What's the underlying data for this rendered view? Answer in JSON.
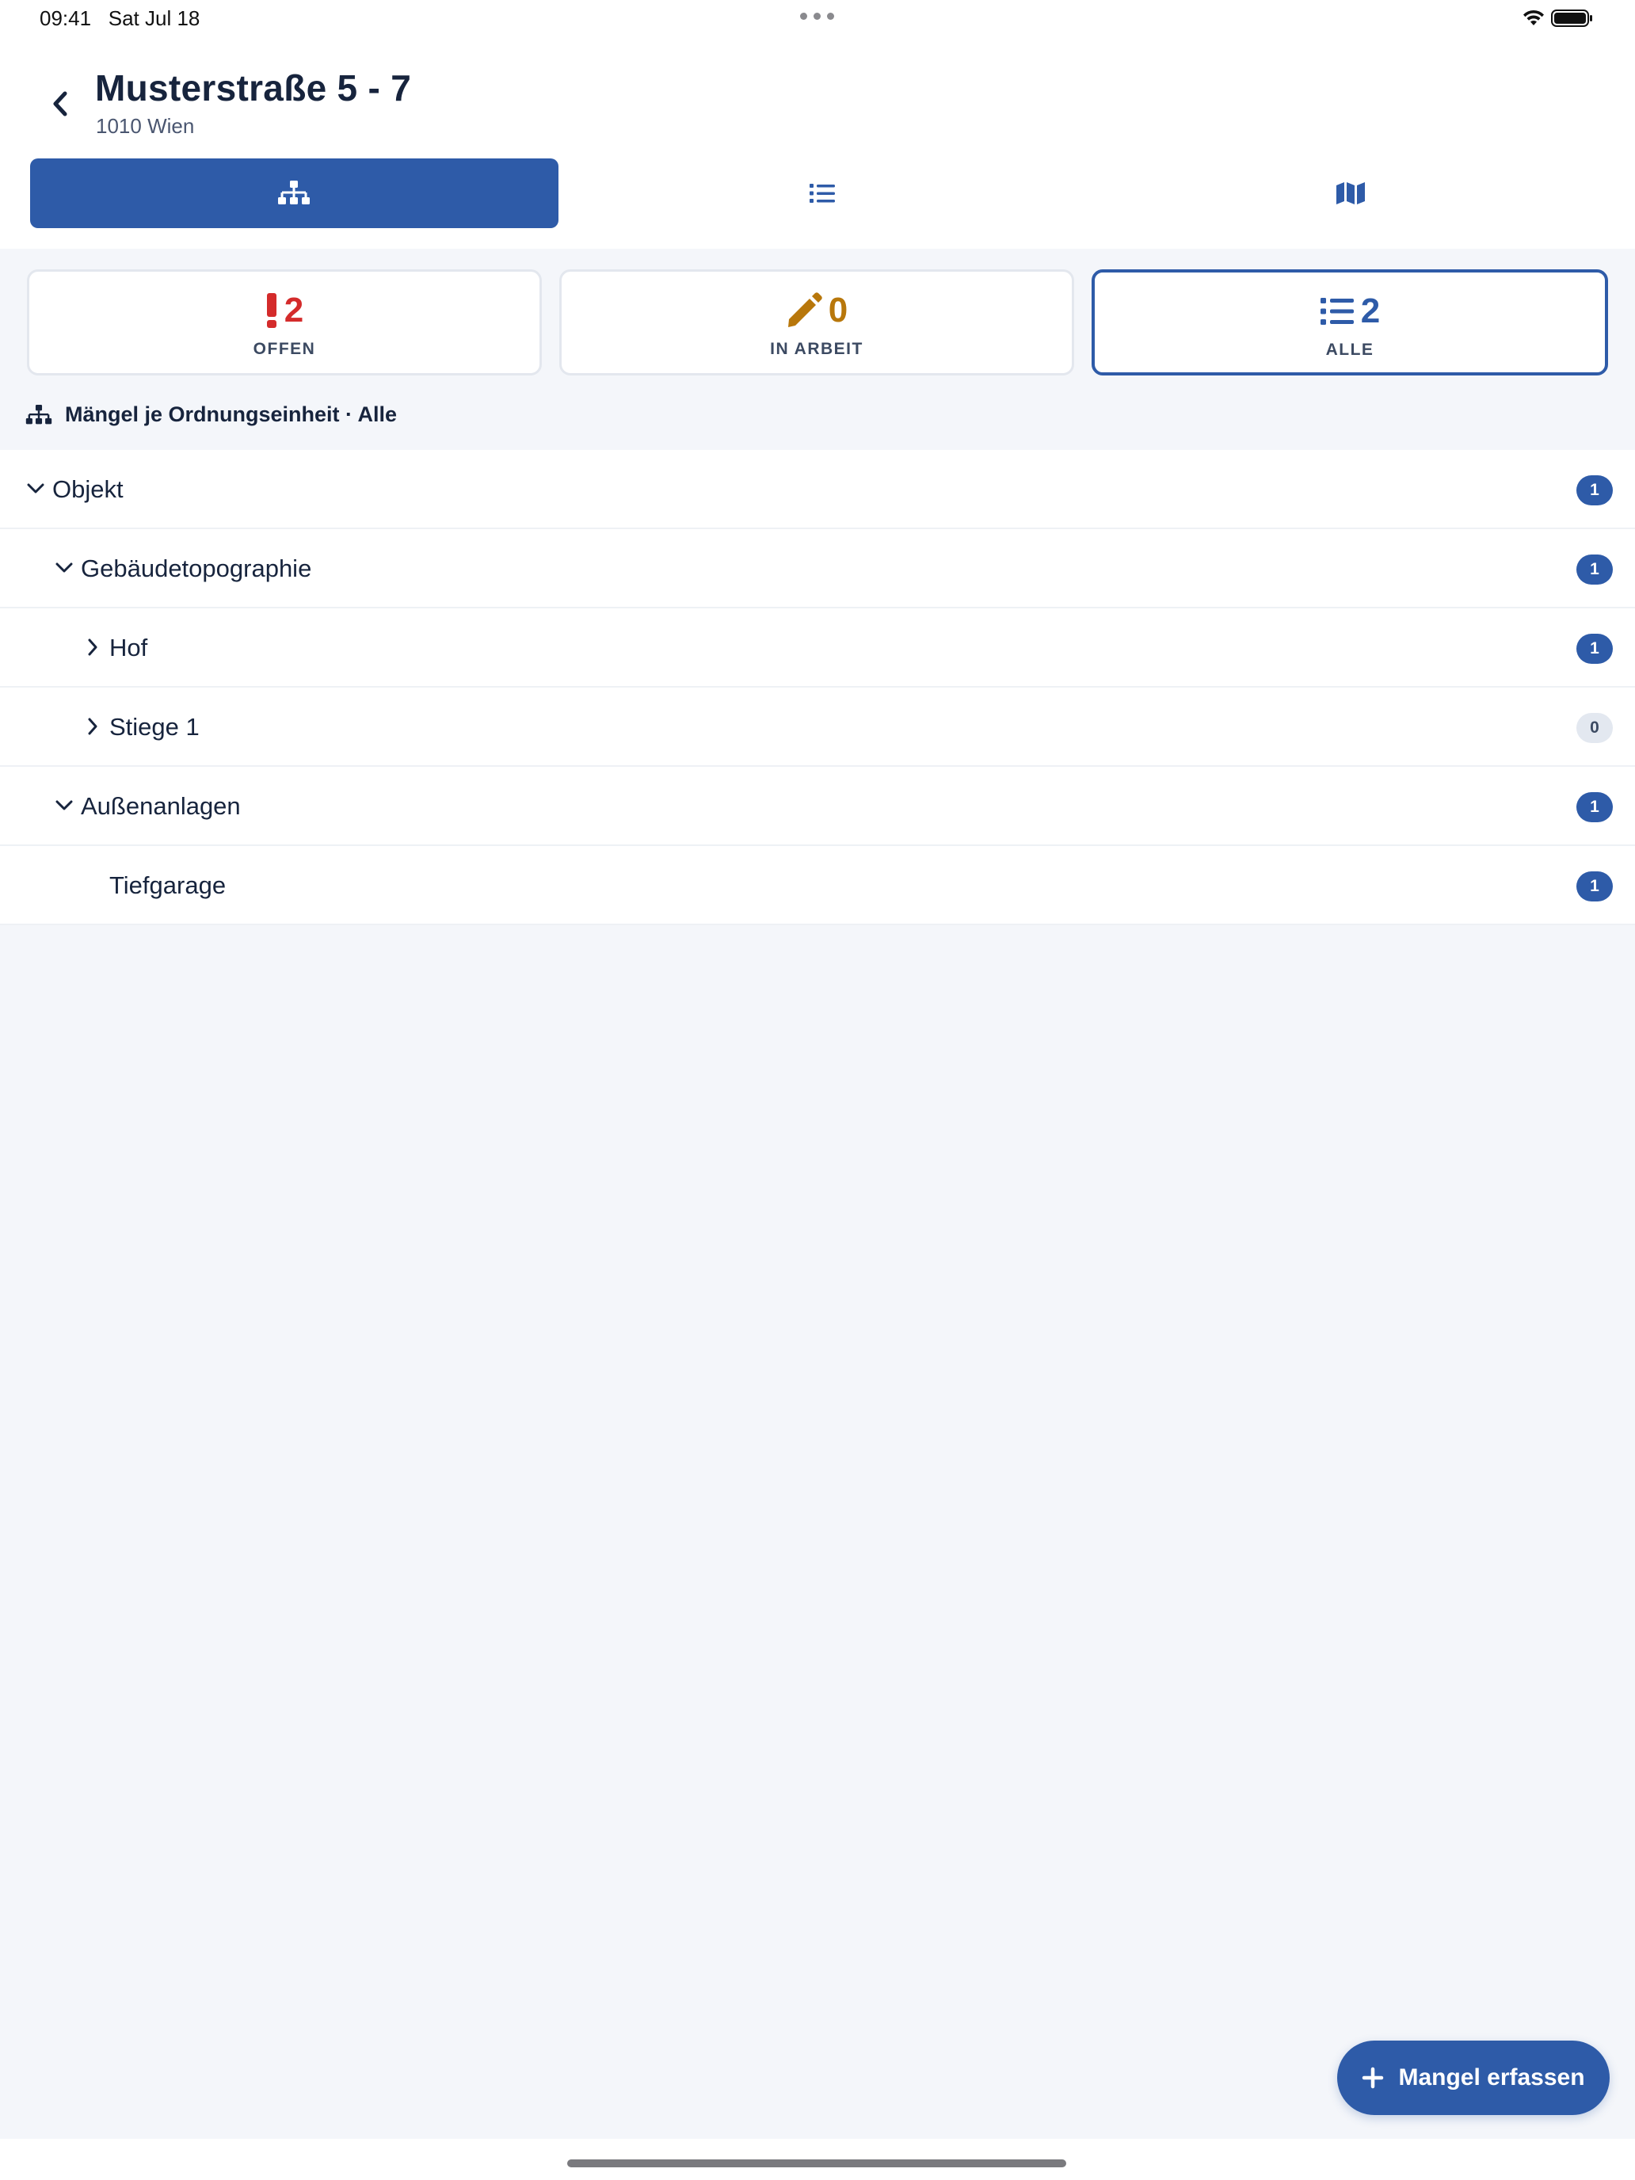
{
  "status_bar": {
    "time": "09:41",
    "date": "Sat Jul 18"
  },
  "header": {
    "title": "Musterstraße 5 - 7",
    "subtitle": "1010 Wien"
  },
  "tabs": [
    {
      "icon": "sitemap-icon",
      "active": true
    },
    {
      "icon": "list-icon",
      "active": false
    },
    {
      "icon": "map-icon",
      "active": false
    }
  ],
  "filters": [
    {
      "count": "2",
      "label": "OFFEN",
      "color": "#d42b2b",
      "icon": "exclamation-icon"
    },
    {
      "count": "0",
      "label": "IN ARBEIT",
      "color": "#b8770b",
      "icon": "pencil-icon"
    },
    {
      "count": "2",
      "label": "ALLE",
      "color": "#2e5ba8",
      "icon": "list-icon",
      "active": true
    }
  ],
  "section": {
    "title": "Mängel je Ordnungseinheit · Alle"
  },
  "tree": [
    {
      "label": "Objekt",
      "count": "1",
      "level": 0,
      "chevron": "down"
    },
    {
      "label": "Gebäudetopographie",
      "count": "1",
      "level": 1,
      "chevron": "down"
    },
    {
      "label": "Hof",
      "count": "1",
      "level": 2,
      "chevron": "right"
    },
    {
      "label": "Stiege 1",
      "count": "0",
      "level": 2,
      "chevron": "right"
    },
    {
      "label": "Außenanlagen",
      "count": "1",
      "level": 1,
      "chevron": "down"
    },
    {
      "label": "Tiefgarage",
      "count": "1",
      "level": 2,
      "chevron": "none"
    }
  ],
  "fab": {
    "label": "Mangel erfassen"
  },
  "colors": {
    "accent": "#2e5ba8",
    "danger": "#d42b2b",
    "warning": "#b8770b",
    "background": "#f4f6fa"
  }
}
